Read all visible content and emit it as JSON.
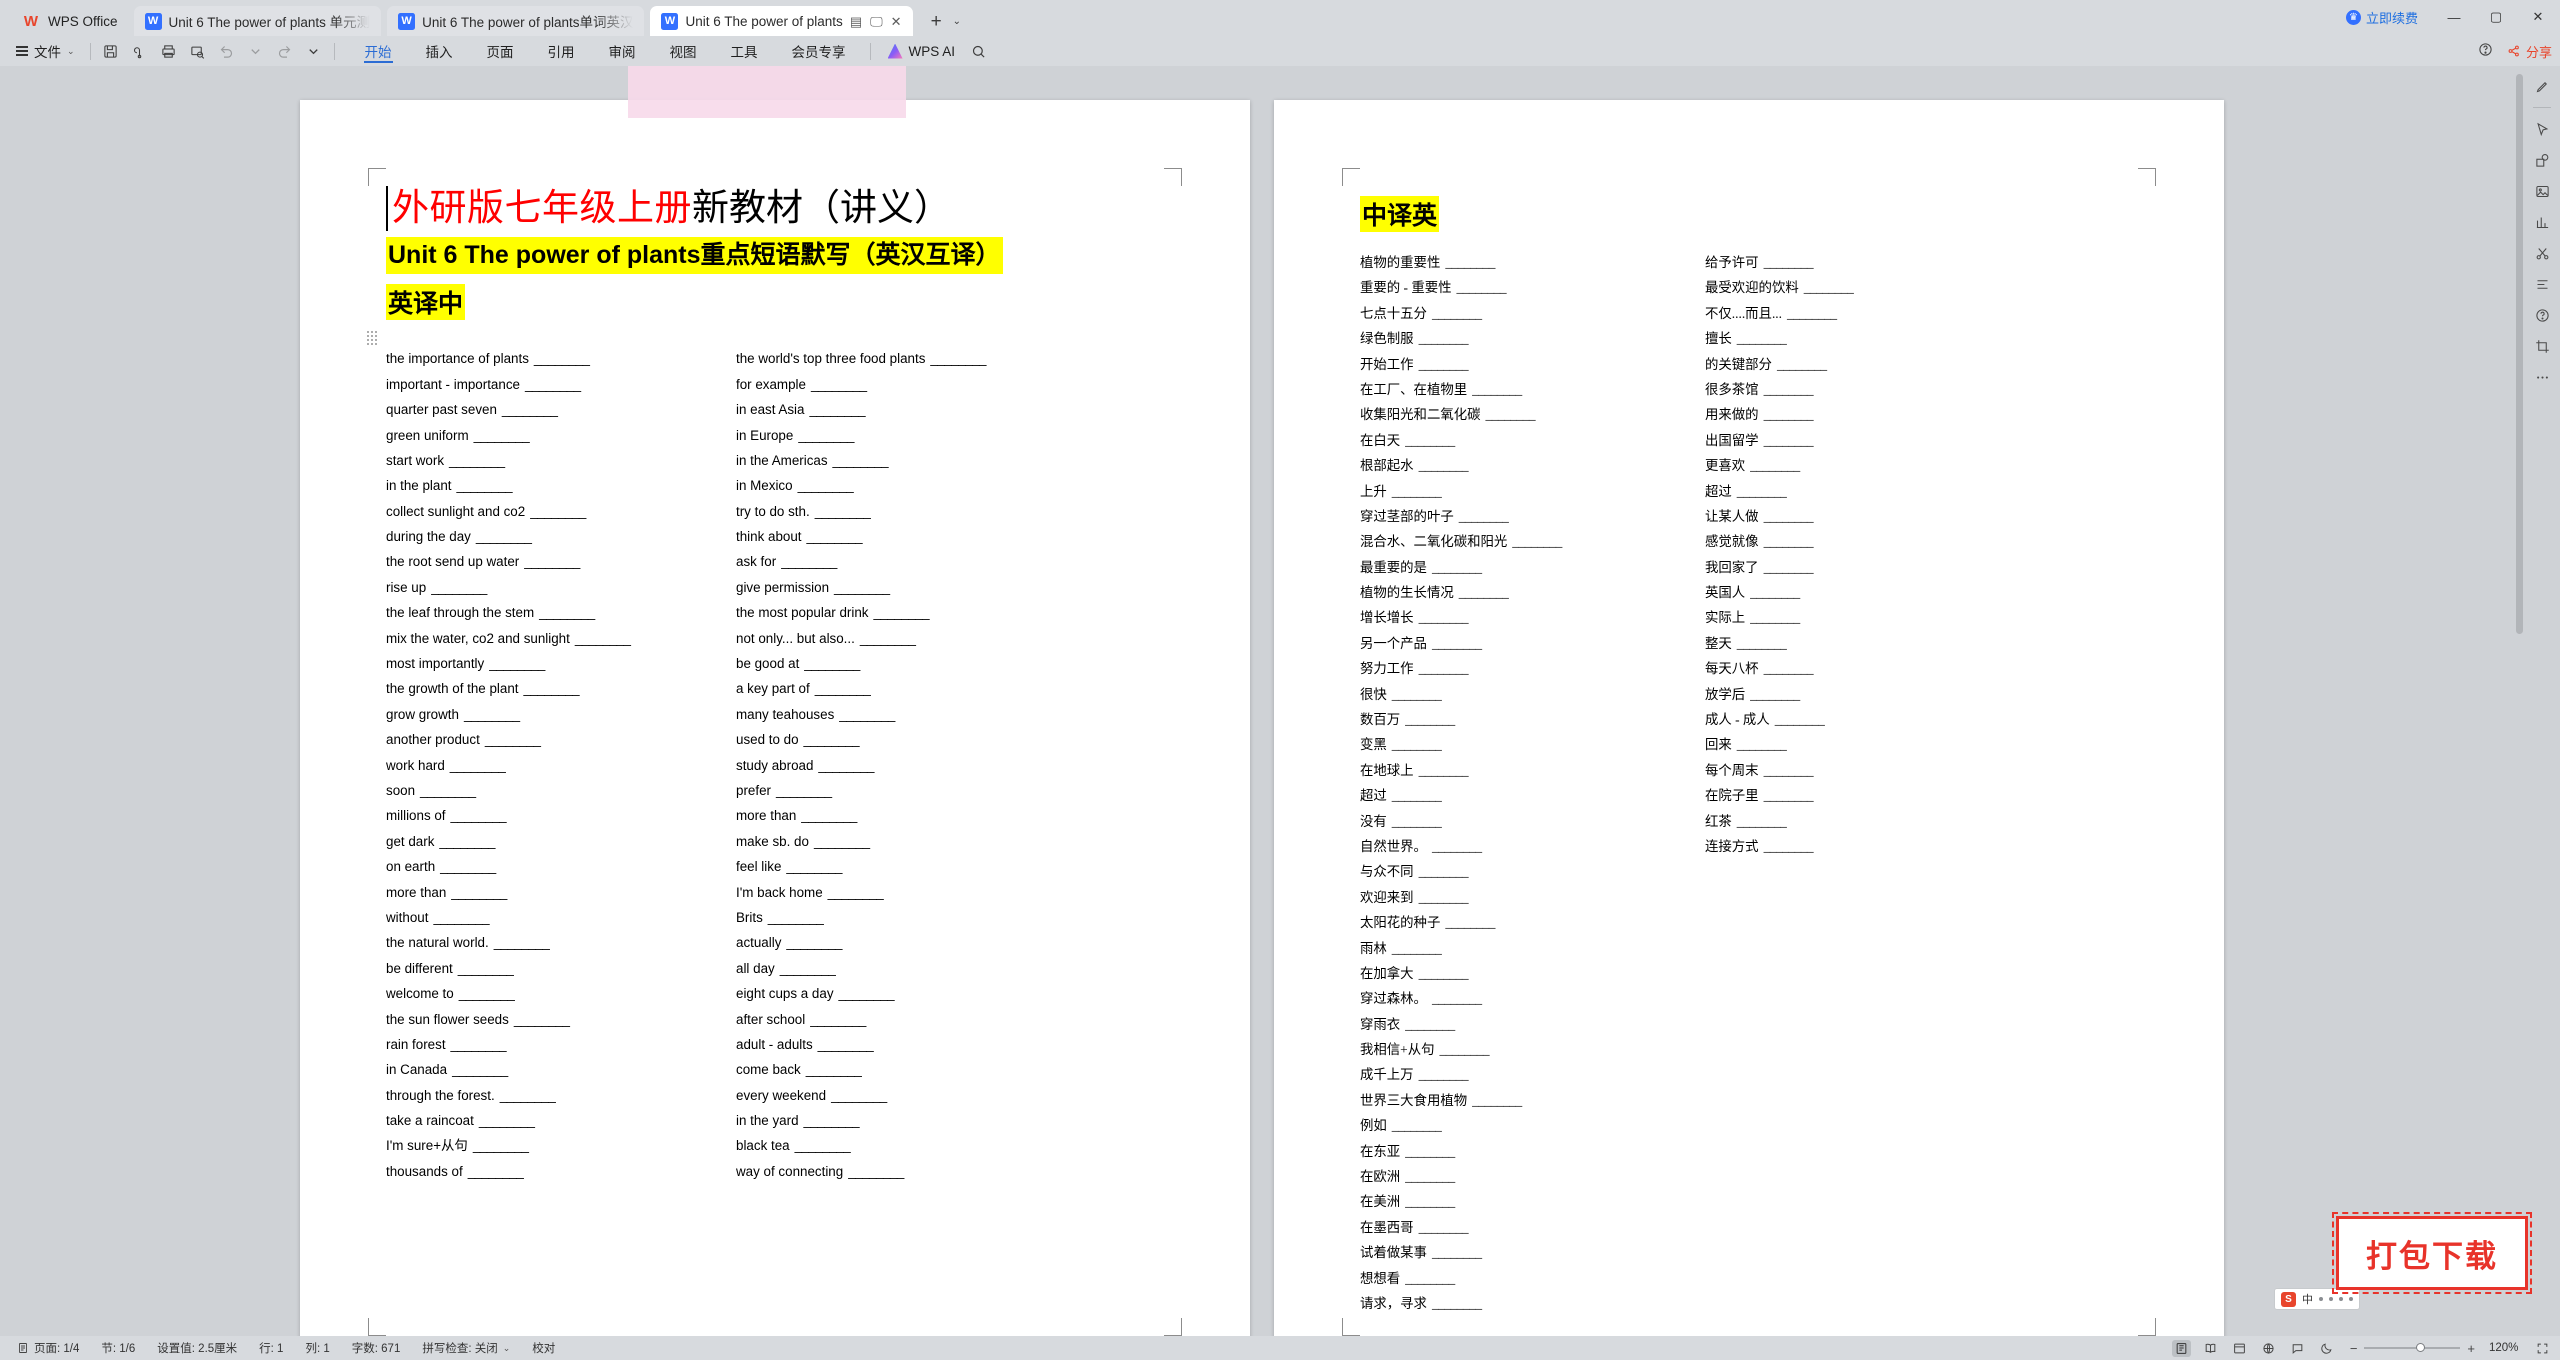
{
  "window": {
    "brand": "WPS Office",
    "brand_icon": "wps-logo-icon",
    "tabs": [
      {
        "label": "Unit 6 The power of plants 单元测",
        "icon": "word-doc-icon",
        "active": false
      },
      {
        "label": "Unit 6 The power of plants单词英汉",
        "icon": "word-doc-icon",
        "active": false
      },
      {
        "label": "Unit 6 The power of plants",
        "icon": "word-doc-icon",
        "active": true
      }
    ],
    "new_tab_icon": "plus-icon",
    "tab_dropdown_icon": "chevron-down-icon",
    "vip_label": "立即续费",
    "vip_icon": "vip-crown-icon",
    "minimize_icon": "minimize-icon",
    "maximize_icon": "maximize-icon",
    "close_icon": "close-icon"
  },
  "ribbon": {
    "file_menu": "文件",
    "quick_icons": [
      "save-icon",
      "cloud-save-icon",
      "print-icon",
      "print-preview-icon",
      "undo-icon",
      "undo-dropdown-icon",
      "redo-icon",
      "customize-dropdown-icon"
    ],
    "tabs": [
      {
        "label": "开始",
        "selected": true
      },
      {
        "label": "插入",
        "selected": false
      },
      {
        "label": "页面",
        "selected": false
      },
      {
        "label": "引用",
        "selected": false
      },
      {
        "label": "审阅",
        "selected": false
      },
      {
        "label": "视图",
        "selected": false
      },
      {
        "label": "工具",
        "selected": false
      },
      {
        "label": "会员专享",
        "selected": false
      }
    ],
    "ai_label": "WPS AI",
    "ai_icon": "wps-ai-icon",
    "search_icon": "search-icon",
    "help_icon": "help-icon",
    "share_label": "分享",
    "share_icon": "share-icon"
  },
  "document": {
    "title_red": "外研版七年级上册",
    "title_black": "新教材（讲义）",
    "subtitle_en": "Unit 6 The power of plants",
    "subtitle_cn": "重点短语默写（英汉互译）",
    "section1": "英译中",
    "section2": "中译英",
    "blank": "________",
    "en_left": [
      "the importance of plants",
      "important - importance",
      "quarter past seven",
      "green uniform",
      "start work",
      "in the plant",
      "collect sunlight and co2",
      "during the day",
      "the root send up water",
      "rise up",
      "the leaf through the stem",
      "mix the water, co2 and sunlight",
      "most importantly",
      "the growth of the plant",
      "grow growth",
      "another product",
      "work hard",
      "soon",
      "millions of",
      "get dark",
      "on earth",
      "more than",
      "without",
      "the natural world.",
      "be different",
      "welcome to",
      "the sun flower seeds",
      "rain forest",
      "in Canada",
      "through the forest.",
      "take a raincoat",
      "I'm sure+从句",
      "thousands of"
    ],
    "en_right": [
      "the world's top three food plants",
      "for example",
      "in east Asia",
      "in Europe",
      "in the Americas",
      "in Mexico",
      "try to do sth.",
      "think about",
      "ask for",
      "give permission",
      "the most popular drink",
      "not only... but also...",
      "be good at",
      "a key part of",
      "many teahouses",
      "used to do",
      "study abroad",
      "prefer",
      "more than",
      "make sb. do",
      "feel like",
      "I'm back home",
      "Brits",
      "actually",
      "all day",
      "eight cups a day",
      "after school",
      "adult - adults",
      "come back",
      "every weekend",
      "in the yard",
      "black tea",
      "way of connecting"
    ],
    "cn_left": [
      "植物的重要性",
      "重要的 - 重要性",
      "七点十五分",
      "绿色制服",
      "开始工作",
      "在工厂、在植物里",
      "收集阳光和二氧化碳",
      "在白天",
      "根部起水",
      "上升",
      "穿过茎部的叶子",
      "混合水、二氧化碳和阳光",
      "最重要的是",
      "植物的生长情况",
      "增长增长",
      "另一个产品",
      "努力工作",
      "很快",
      "数百万",
      "变黑",
      "在地球上",
      "超过",
      "没有",
      "自然世界。",
      "与众不同",
      "欢迎来到",
      "太阳花的种子",
      "雨林",
      "在加拿大",
      "穿过森林。",
      "穿雨衣",
      "我相信+从句",
      "成千上万",
      "世界三大食用植物",
      "例如",
      "在东亚",
      "在欧洲",
      "在美洲",
      "在墨西哥",
      "试着做某事",
      "想想看",
      "请求，寻求"
    ],
    "cn_right": [
      "给予许可",
      "最受欢迎的饮料",
      "不仅....而且...",
      "擅长",
      "的关键部分",
      "很多茶馆",
      "用来做的",
      "出国留学",
      "更喜欢",
      "超过",
      "让某人做",
      "感觉就像",
      "我回家了",
      "英国人",
      "实际上",
      "整天",
      "每天八杯",
      "放学后",
      "成人 - 成人",
      "回来",
      "每个周末",
      "在院子里",
      "红茶",
      "连接方式"
    ]
  },
  "statusbar": {
    "items": [
      "页面: 1/4",
      "节: 1/6",
      "设置值: 2.5厘米",
      "行: 1",
      "列: 1",
      "字数: 671",
      "拼写检查: 关闭",
      "校对"
    ],
    "page_icon": "page-icon",
    "spell_dropdown_icon": "chevron-down-icon",
    "view_icons": [
      "page-layout-icon",
      "reading-view-icon",
      "web-layout-icon",
      "global-icon",
      "comment-icon",
      "dark-mode-icon"
    ],
    "zoom_out_icon": "minus-icon",
    "zoom_in_icon": "plus-icon",
    "zoom_level": "120%",
    "fullscreen_icon": "fullscreen-icon"
  },
  "sidebar_rail": {
    "icons": [
      "pen-icon",
      "cursor-icon",
      "shapes-icon",
      "image-icon",
      "chart-icon",
      "scissors-icon",
      "format-icon",
      "help-circle-icon",
      "crop-icon",
      "more-icon"
    ]
  },
  "overlays": {
    "download_stamp": "打包下载",
    "ime_label": "中",
    "ime_icon": "sogou-s-icon"
  }
}
